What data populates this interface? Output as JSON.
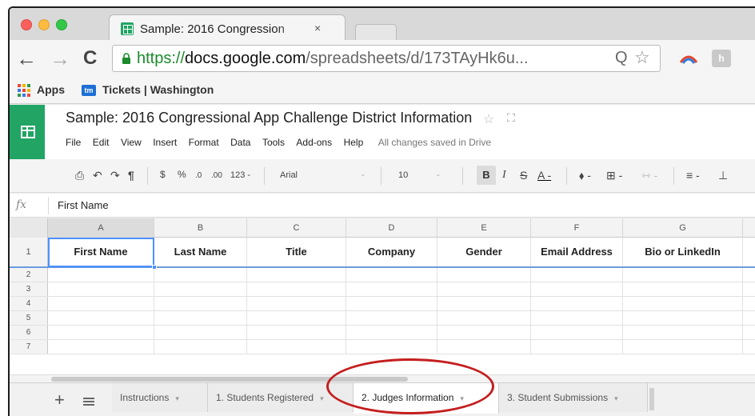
{
  "browser": {
    "tab_title": "Sample: 2016 Congression",
    "tab_close": "×",
    "url_scheme": "https://",
    "url_host": "docs.google.com",
    "url_path": "/spreadsheets/d/173TAyHk6u...",
    "zoom_glyph": "Q",
    "star_glyph": "☆",
    "ext2_label": "h",
    "nav_back": "←",
    "nav_forward": "→",
    "nav_reload": "C",
    "bookmarks": {
      "apps": "Apps",
      "tickets_icon": "tm",
      "tickets": "Tickets | Washington"
    }
  },
  "sheets": {
    "doc_title": "Sample: 2016 Congressional App Challenge District Information",
    "star": "☆",
    "folder": "⛶",
    "menu": [
      "File",
      "Edit",
      "View",
      "Insert",
      "Format",
      "Data",
      "Tools",
      "Add-ons",
      "Help"
    ],
    "save_status": "All changes saved in Drive",
    "toolbar": {
      "print": "⎙",
      "undo": "↶",
      "redo": "↷",
      "paint": "¶",
      "currency": "$",
      "percent": "%",
      "dec_less": ".0",
      "dec_more": ".00",
      "number_format": "123 -",
      "font": "Arial",
      "font_caret": "-",
      "font_size": "10",
      "size_caret": "-",
      "bold": "B",
      "italic": "I",
      "strike": "S",
      "text_color": "A -",
      "fill": "⬧ -",
      "borders": "⊞ -",
      "merge": "⇿ -",
      "align": "≡ -",
      "valign": "⊥"
    },
    "formula": {
      "fx": "fx",
      "value": "First Name"
    },
    "columns": [
      "A",
      "B",
      "C",
      "D",
      "E",
      "F",
      "G"
    ],
    "header_row": {
      "number": "1",
      "cells": [
        "First Name",
        "Last Name",
        "Title",
        "Company",
        "Gender",
        "Email Address",
        "Bio or LinkedIn"
      ]
    },
    "empty_rows": [
      "2",
      "3",
      "4",
      "5",
      "6",
      "7"
    ],
    "sheet_controls": {
      "add": "+"
    },
    "tabs": [
      {
        "label": "Instructions",
        "caret": "▾",
        "active": false
      },
      {
        "label": "1. Students Registered",
        "caret": "▾",
        "active": false
      },
      {
        "label": "2. Judges Information",
        "caret": "▾",
        "active": true
      },
      {
        "label": "3. Student Submissions",
        "caret": "▾",
        "active": false
      }
    ]
  },
  "colors": {
    "sheets_green": "#21a464",
    "url_green": "#1b8a2c",
    "selection_blue": "#4d90fe",
    "annotation_red": "#c41e1e"
  }
}
